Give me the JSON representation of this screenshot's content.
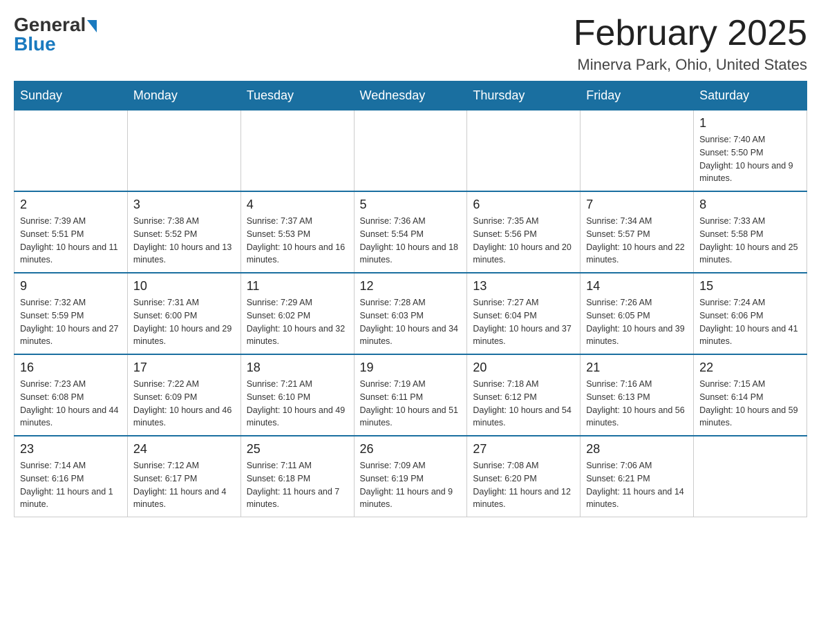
{
  "logo": {
    "general": "General",
    "blue": "Blue"
  },
  "header": {
    "month": "February 2025",
    "location": "Minerva Park, Ohio, United States"
  },
  "days_of_week": [
    "Sunday",
    "Monday",
    "Tuesday",
    "Wednesday",
    "Thursday",
    "Friday",
    "Saturday"
  ],
  "weeks": [
    [
      {
        "day": "",
        "info": ""
      },
      {
        "day": "",
        "info": ""
      },
      {
        "day": "",
        "info": ""
      },
      {
        "day": "",
        "info": ""
      },
      {
        "day": "",
        "info": ""
      },
      {
        "day": "",
        "info": ""
      },
      {
        "day": "1",
        "info": "Sunrise: 7:40 AM\nSunset: 5:50 PM\nDaylight: 10 hours and 9 minutes."
      }
    ],
    [
      {
        "day": "2",
        "info": "Sunrise: 7:39 AM\nSunset: 5:51 PM\nDaylight: 10 hours and 11 minutes."
      },
      {
        "day": "3",
        "info": "Sunrise: 7:38 AM\nSunset: 5:52 PM\nDaylight: 10 hours and 13 minutes."
      },
      {
        "day": "4",
        "info": "Sunrise: 7:37 AM\nSunset: 5:53 PM\nDaylight: 10 hours and 16 minutes."
      },
      {
        "day": "5",
        "info": "Sunrise: 7:36 AM\nSunset: 5:54 PM\nDaylight: 10 hours and 18 minutes."
      },
      {
        "day": "6",
        "info": "Sunrise: 7:35 AM\nSunset: 5:56 PM\nDaylight: 10 hours and 20 minutes."
      },
      {
        "day": "7",
        "info": "Sunrise: 7:34 AM\nSunset: 5:57 PM\nDaylight: 10 hours and 22 minutes."
      },
      {
        "day": "8",
        "info": "Sunrise: 7:33 AM\nSunset: 5:58 PM\nDaylight: 10 hours and 25 minutes."
      }
    ],
    [
      {
        "day": "9",
        "info": "Sunrise: 7:32 AM\nSunset: 5:59 PM\nDaylight: 10 hours and 27 minutes."
      },
      {
        "day": "10",
        "info": "Sunrise: 7:31 AM\nSunset: 6:00 PM\nDaylight: 10 hours and 29 minutes."
      },
      {
        "day": "11",
        "info": "Sunrise: 7:29 AM\nSunset: 6:02 PM\nDaylight: 10 hours and 32 minutes."
      },
      {
        "day": "12",
        "info": "Sunrise: 7:28 AM\nSunset: 6:03 PM\nDaylight: 10 hours and 34 minutes."
      },
      {
        "day": "13",
        "info": "Sunrise: 7:27 AM\nSunset: 6:04 PM\nDaylight: 10 hours and 37 minutes."
      },
      {
        "day": "14",
        "info": "Sunrise: 7:26 AM\nSunset: 6:05 PM\nDaylight: 10 hours and 39 minutes."
      },
      {
        "day": "15",
        "info": "Sunrise: 7:24 AM\nSunset: 6:06 PM\nDaylight: 10 hours and 41 minutes."
      }
    ],
    [
      {
        "day": "16",
        "info": "Sunrise: 7:23 AM\nSunset: 6:08 PM\nDaylight: 10 hours and 44 minutes."
      },
      {
        "day": "17",
        "info": "Sunrise: 7:22 AM\nSunset: 6:09 PM\nDaylight: 10 hours and 46 minutes."
      },
      {
        "day": "18",
        "info": "Sunrise: 7:21 AM\nSunset: 6:10 PM\nDaylight: 10 hours and 49 minutes."
      },
      {
        "day": "19",
        "info": "Sunrise: 7:19 AM\nSunset: 6:11 PM\nDaylight: 10 hours and 51 minutes."
      },
      {
        "day": "20",
        "info": "Sunrise: 7:18 AM\nSunset: 6:12 PM\nDaylight: 10 hours and 54 minutes."
      },
      {
        "day": "21",
        "info": "Sunrise: 7:16 AM\nSunset: 6:13 PM\nDaylight: 10 hours and 56 minutes."
      },
      {
        "day": "22",
        "info": "Sunrise: 7:15 AM\nSunset: 6:14 PM\nDaylight: 10 hours and 59 minutes."
      }
    ],
    [
      {
        "day": "23",
        "info": "Sunrise: 7:14 AM\nSunset: 6:16 PM\nDaylight: 11 hours and 1 minute."
      },
      {
        "day": "24",
        "info": "Sunrise: 7:12 AM\nSunset: 6:17 PM\nDaylight: 11 hours and 4 minutes."
      },
      {
        "day": "25",
        "info": "Sunrise: 7:11 AM\nSunset: 6:18 PM\nDaylight: 11 hours and 7 minutes."
      },
      {
        "day": "26",
        "info": "Sunrise: 7:09 AM\nSunset: 6:19 PM\nDaylight: 11 hours and 9 minutes."
      },
      {
        "day": "27",
        "info": "Sunrise: 7:08 AM\nSunset: 6:20 PM\nDaylight: 11 hours and 12 minutes."
      },
      {
        "day": "28",
        "info": "Sunrise: 7:06 AM\nSunset: 6:21 PM\nDaylight: 11 hours and 14 minutes."
      },
      {
        "day": "",
        "info": ""
      }
    ]
  ]
}
